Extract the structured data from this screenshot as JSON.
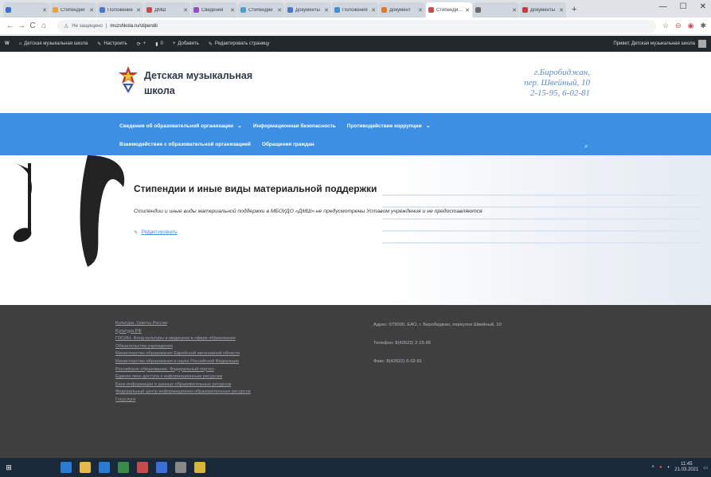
{
  "browser": {
    "tabs": [
      {
        "label": "",
        "color": "#3a6fd8",
        "active": false
      },
      {
        "label": "Стипендии",
        "color": "#e8a23a",
        "active": false
      },
      {
        "label": "Положение",
        "color": "#4a78d0",
        "active": false
      },
      {
        "label": "ДМШ",
        "color": "#c94a4a",
        "active": false
      },
      {
        "label": "Сведения",
        "color": "#9a4ac9",
        "active": false
      },
      {
        "label": "Стипендии",
        "color": "#4aa0c9",
        "active": false
      },
      {
        "label": "Документы",
        "color": "#4a78d0",
        "active": false
      },
      {
        "label": "Положения",
        "color": "#3a8fd8",
        "active": false
      },
      {
        "label": "Документ",
        "color": "#e07a2a",
        "active": false
      },
      {
        "label": "Стипендии и",
        "color": "#c94a4a",
        "active": true
      },
      {
        "label": "",
        "color": "#6a6a6a",
        "active": false
      },
      {
        "label": "Документы",
        "color": "#c93a3a",
        "active": false
      }
    ],
    "new_tab": "+",
    "window_controls": {
      "minimize": "—",
      "maximize": "☐",
      "close": "✕"
    },
    "nav": {
      "back": "←",
      "forward": "→",
      "reload": "C",
      "home": "⌂"
    },
    "address": {
      "security": "Не защищено",
      "url": "muzshkola.ru/stipendii"
    },
    "right_icons": [
      "☆",
      "⊖",
      "◉",
      "✱"
    ]
  },
  "admin_bar": {
    "wp_logo": "W",
    "site_name": "Детская музыкальная школа",
    "customize": "Настроить",
    "comments_count": "0",
    "new_count": "+",
    "add_new": "Добавить",
    "edit_page": "Редактировать страницу",
    "greeting": "Привет, Детская музыкальная школа"
  },
  "header": {
    "title_line1": "Детская музыкальная",
    "title_line2": "школа",
    "contact_line1": "г.Биробиджан,",
    "contact_line2": "пер. Швейный, 10",
    "contact_line3": "2-15-95, 6-02-81"
  },
  "nav": {
    "row1": [
      {
        "label": "Сведения об образовательной организации",
        "caret": "⌄"
      },
      {
        "label": "Информационная безопасность",
        "caret": ""
      },
      {
        "label": "Противодействие коррупции",
        "caret": "⌄"
      }
    ],
    "row2": [
      {
        "label": "Взаимодействие с образовательной организацией",
        "caret": ""
      },
      {
        "label": "Обращения граждан",
        "caret": ""
      }
    ],
    "search_icon": "⌕"
  },
  "content": {
    "title": "Стипендии и иные виды материальной поддержки",
    "text": "Стипендии и иные виды материальной поддержки в МБОУДО «ДМШ» не предусмотрены Уставом учреждения и не предоставляются",
    "edit_link": "Редактировать",
    "edit_icon": "pencil-icon"
  },
  "footer": {
    "links": [
      "Культура. Гранты России",
      "Культура.РФ",
      "ГОСИН. Фонд культуры и медицина в сфере образования",
      "Обязательства учреждения",
      "Министерство образования Еврейской автономной области",
      "Министерство образования и науки Российской Федерации",
      "Российское образование. Федеральный портал",
      "Единое окно доступа к информационным ресурсам",
      "Банк информации и данных образовательных ресурсов",
      "Федеральный центр информационно-образовательных ресурсов",
      "Госуслуги"
    ],
    "address": "Адрес: 679000, ЕАО, г. Биробиджан, переулок Швейный, 10",
    "phone": "Телефон: 8(42622) 2-15-95",
    "fax": "Факс: 8(42622) 6-02-81"
  },
  "taskbar": {
    "start_icon": "⊞",
    "items": [
      {
        "icon": "search-icon",
        "color": "#1b2a3a"
      },
      {
        "icon": "task-view-icon",
        "color": "#1b2a3a"
      },
      {
        "icon": "edge-icon",
        "color": "#2b7bd3"
      },
      {
        "icon": "folder-icon",
        "color": "#e8b84a"
      },
      {
        "icon": "store-icon",
        "color": "#2b7bd3"
      },
      {
        "icon": "chrome-icon",
        "color": "#3a8a4a"
      },
      {
        "icon": "app-red-icon",
        "color": "#c94a4a"
      },
      {
        "icon": "app-blue-icon",
        "color": "#3a6fd8"
      },
      {
        "icon": "app-gray-icon",
        "color": "#888"
      },
      {
        "icon": "app-yellow-icon",
        "color": "#d8b43a"
      }
    ],
    "clock_time": "11:45",
    "clock_date": "21.03.2021"
  },
  "colors": {
    "nav_bg": "#3c8fe3",
    "footer_bg": "#3f3f40",
    "admin_bar_bg": "#23282d",
    "link": "#4a90d9"
  }
}
